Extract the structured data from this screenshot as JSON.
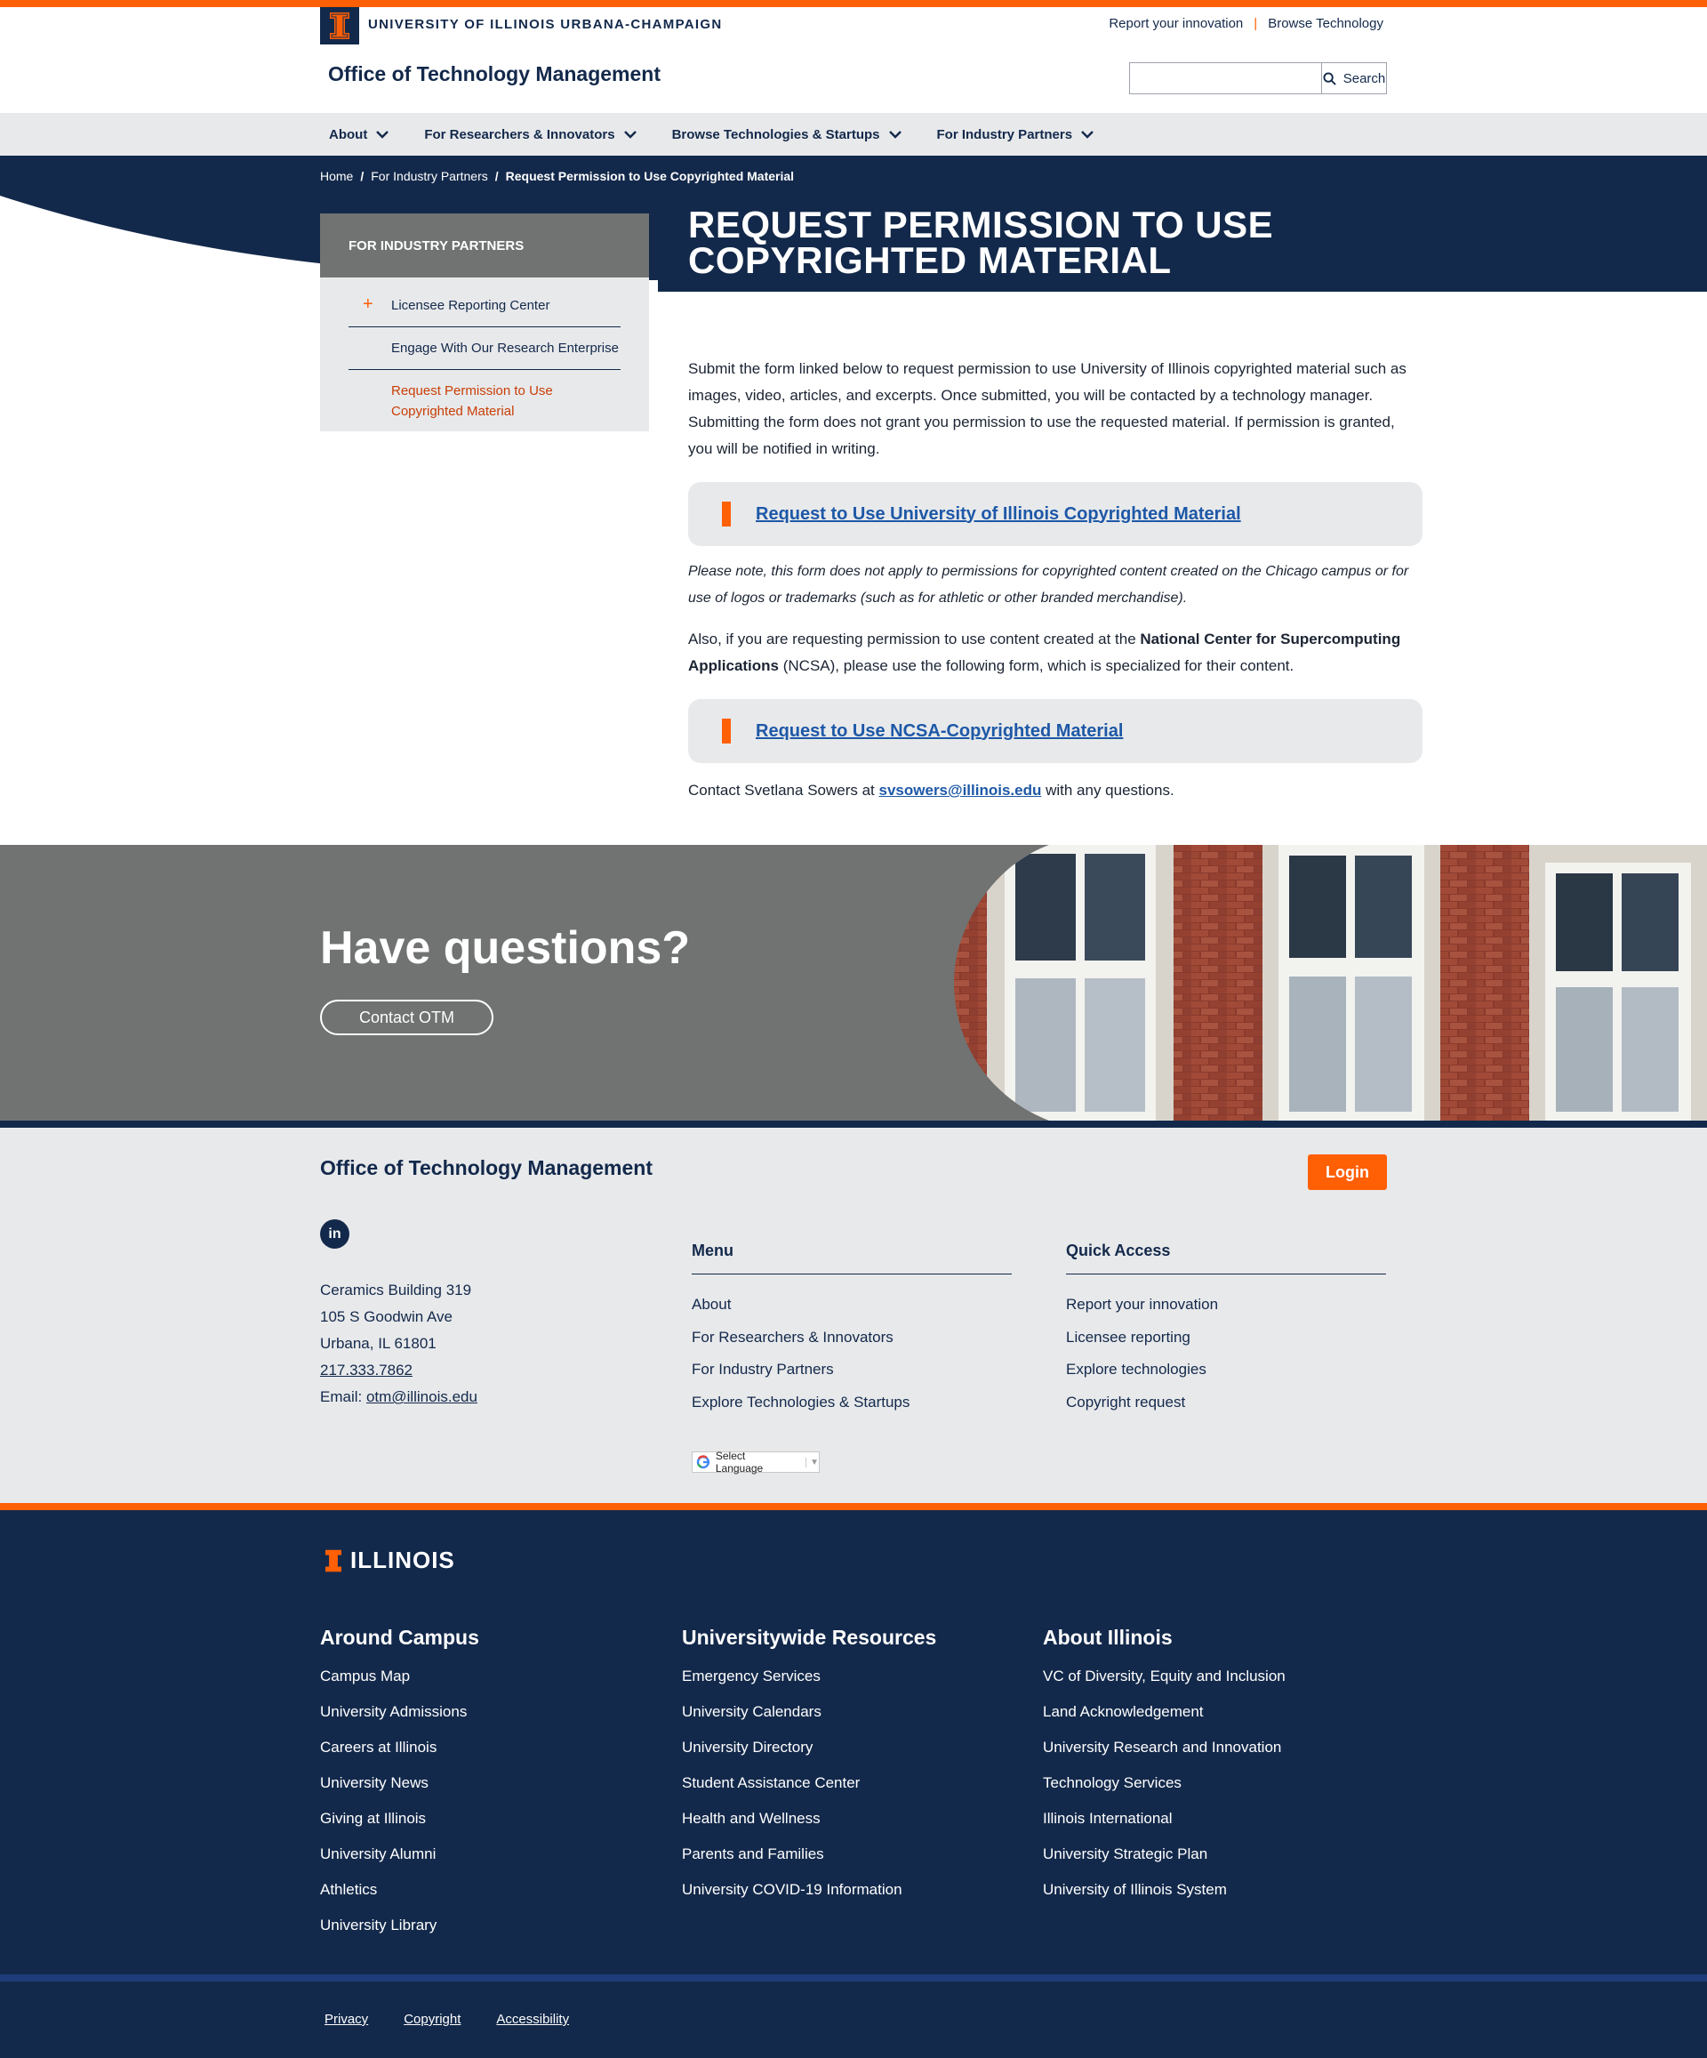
{
  "header": {
    "wordmark": "UNIVERSITY OF ILLINOIS URBANA-CHAMPAIGN",
    "util_links": [
      "Report your innovation",
      "Browse Technology"
    ],
    "site_title": "Office of Technology Management",
    "search": {
      "placeholder": "",
      "button_label": "Search"
    },
    "nav": [
      "About",
      "For Researchers & Innovators",
      "Browse Technologies & Startups",
      "For Industry Partners"
    ]
  },
  "breadcrumb": {
    "items": [
      "Home",
      "For Industry Partners"
    ],
    "current": "Request Permission to Use Copyrighted Material"
  },
  "page_title": "REQUEST PERMISSION TO USE COPYRIGHTED MATERIAL",
  "sidebar": {
    "heading": "FOR INDUSTRY PARTNERS",
    "items": [
      {
        "label": "Licensee Reporting Center",
        "expand": "+"
      },
      {
        "label": "Engage With Our Research Enterprise"
      },
      {
        "label": "Request Permission to Use Copyrighted Material"
      }
    ]
  },
  "content": {
    "intro": "Submit the form linked below to request permission to use University of Illinois copyrighted material such as images, video, articles, and excerpts. Once submitted, you will be contacted by a technology manager.  Submitting the form does not grant you permission to use the requested material. If permission is granted, you will be notified in writing.",
    "cta1": "Request to Use University of Illinois Copyrighted Material",
    "note": "Please note, this form does not apply to permissions for copyrighted content created on the Chicago campus or for use of logos or trademarks (such as for athletic or other branded merchandise).",
    "also_pre": "Also, if you are requesting permission to use content created at the ",
    "also_bold": "National Center for Supercomputing Applications",
    "also_post": " (NCSA), please use the following form, which is specialized for their content.",
    "cta2": "Request to Use NCSA-Copyrighted Material",
    "contact_pre": "Contact Svetlana Sowers at ",
    "contact_email": "svsowers@illinois.edu",
    "contact_post": " with any questions."
  },
  "questions": {
    "heading": "Have questions?",
    "button": "Contact OTM"
  },
  "otm_footer": {
    "title": "Office of Technology Management",
    "login": "Login",
    "linkedin": "in",
    "address": [
      "Ceramics Building 319",
      "105 S Goodwin Ave",
      "Urbana, IL 61801"
    ],
    "phone": "217.333.7862",
    "email_label": "Email: ",
    "email": "otm@illinois.edu",
    "menu": {
      "heading": "Menu",
      "items": [
        "About",
        "For Researchers & Innovators",
        "For Industry Partners",
        "Explore Technologies & Startups"
      ]
    },
    "quick": {
      "heading": "Quick Access",
      "items": [
        "Report your innovation",
        "Licensee reporting",
        "Explore technologies",
        "Copyright request"
      ]
    },
    "translate": "Select Language"
  },
  "campus_footer": {
    "logo_text": "ILLINOIS",
    "around": {
      "heading": "Around Campus",
      "items": [
        "Campus Map",
        "University Admissions",
        "Careers at Illinois",
        "University News",
        "Giving at Illinois",
        "University Alumni",
        "Athletics",
        "University Library"
      ]
    },
    "resources": {
      "heading": "Universitywide Resources",
      "items": [
        "Emergency Services",
        "University Calendars",
        "University Directory",
        "Student Assistance Center",
        "Health and Wellness",
        "Parents and Families",
        "University COVID-19 Information"
      ]
    },
    "about": {
      "heading": "About Illinois",
      "items": [
        "VC of Diversity, Equity and Inclusion",
        "Land Acknowledgement",
        "University Research and Innovation",
        "Technology Services",
        "Illinois International",
        "University Strategic Plan",
        "University of Illinois System"
      ]
    },
    "legal": [
      "Privacy",
      "Copyright",
      "Accessibility"
    ]
  },
  "colors": {
    "navy": "#13294b",
    "orange": "#ff5f05",
    "gray": "#707372",
    "light_gray": "#e8e9eb",
    "link_blue": "#1d58a7"
  }
}
